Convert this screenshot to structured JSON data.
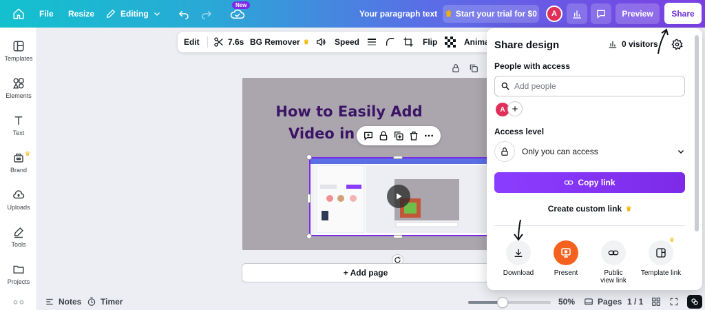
{
  "topbar": {
    "file": "File",
    "resize": "Resize",
    "editing": "Editing",
    "new_badge": "New",
    "doc_title": "Your paragraph text",
    "trial": "Start your trial for $0",
    "avatar": "A",
    "preview": "Preview",
    "share": "Share"
  },
  "sidebar": {
    "items": [
      {
        "label": "Templates",
        "icon": "templates-icon"
      },
      {
        "label": "Elements",
        "icon": "elements-icon"
      },
      {
        "label": "Text",
        "icon": "text-icon"
      },
      {
        "label": "Brand",
        "icon": "brand-icon"
      },
      {
        "label": "Uploads",
        "icon": "uploads-icon"
      },
      {
        "label": "Tools",
        "icon": "tools-icon"
      },
      {
        "label": "Projects",
        "icon": "projects-icon"
      }
    ]
  },
  "toolbar": {
    "edit": "Edit",
    "duration": "7.6s",
    "bg_remover": "BG Remover",
    "speed": "Speed",
    "flip": "Flip",
    "animate": "Anima"
  },
  "canvas": {
    "slide_title": "How to Easily Add Video in Canva",
    "add_page": "+ Add page"
  },
  "bottom": {
    "notes": "Notes",
    "timer": "Timer",
    "zoom": "50%",
    "zoom_level": 0.42,
    "pages_label": "Pages",
    "pages_count": "1 / 1"
  },
  "share_panel": {
    "title": "Share design",
    "visitors": "0 visitors",
    "people_label": "People with access",
    "search_placeholder": "Add people",
    "avatar": "A",
    "access_label": "Access level",
    "access_value": "Only you can access",
    "copy_link": "Copy link",
    "custom_link": "Create custom link",
    "options": [
      {
        "label": "Download",
        "icon": "download-icon"
      },
      {
        "label": "Present",
        "icon": "present-icon"
      },
      {
        "label": "Public view link",
        "icon": "link-icon"
      },
      {
        "label": "Template link",
        "icon": "template-link-icon"
      }
    ]
  },
  "colors": {
    "brand_purple": "#7d2ae8",
    "present_orange": "#f5621f",
    "slide_bg": "#aba6ad",
    "title_color": "#3b1466"
  }
}
